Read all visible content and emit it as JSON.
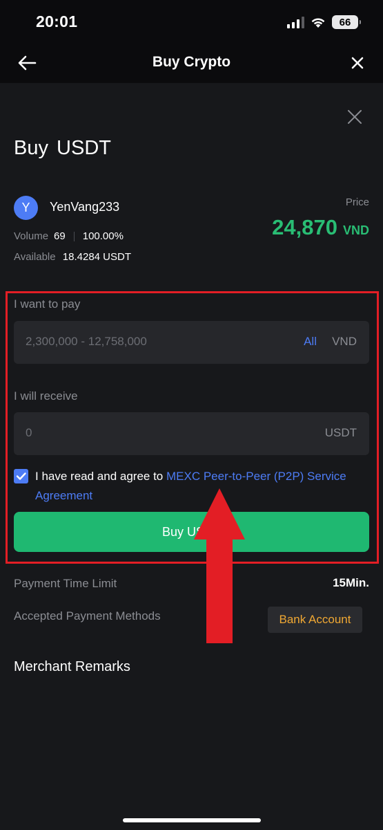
{
  "status_bar": {
    "time": "20:01",
    "battery": "66"
  },
  "nav": {
    "title": "Buy Crypto",
    "back_icon": "arrow-left-icon",
    "close_icon": "close-icon"
  },
  "sheet": {
    "close_icon": "close-icon",
    "title": "Buy USDT",
    "merchant": {
      "avatar_letter": "Y",
      "name": "YenVang233",
      "volume_label": "Volume",
      "volume_value": "69",
      "completion_rate": "100.00%",
      "available_label": "Available",
      "available_value": "18.4284 USDT"
    },
    "price": {
      "label": "Price",
      "value": "24,870",
      "currency": "VND"
    },
    "pay": {
      "label": "I want to pay",
      "placeholder": "2,300,000 - 12,758,000",
      "all_label": "All",
      "unit": "VND"
    },
    "receive": {
      "label": "I will receive",
      "placeholder": "0",
      "unit": "USDT"
    },
    "agreement": {
      "checked": true,
      "text": "I have read and agree to ",
      "link": "MEXC Peer-to-Peer (P2P) Service Agreement"
    },
    "buy_button": "Buy USDT",
    "payment_time_limit": {
      "label": "Payment Time Limit",
      "value": "15Min."
    },
    "payment_methods": {
      "label": "Accepted Payment Methods",
      "value": "Bank Account"
    },
    "remarks_title": "Merchant Remarks"
  },
  "colors": {
    "accent_blue": "#4d7cf5",
    "price_green": "#29bd74",
    "button_green": "#1fb871",
    "highlight_red": "#e31e25",
    "bank_orange": "#f0a833"
  }
}
